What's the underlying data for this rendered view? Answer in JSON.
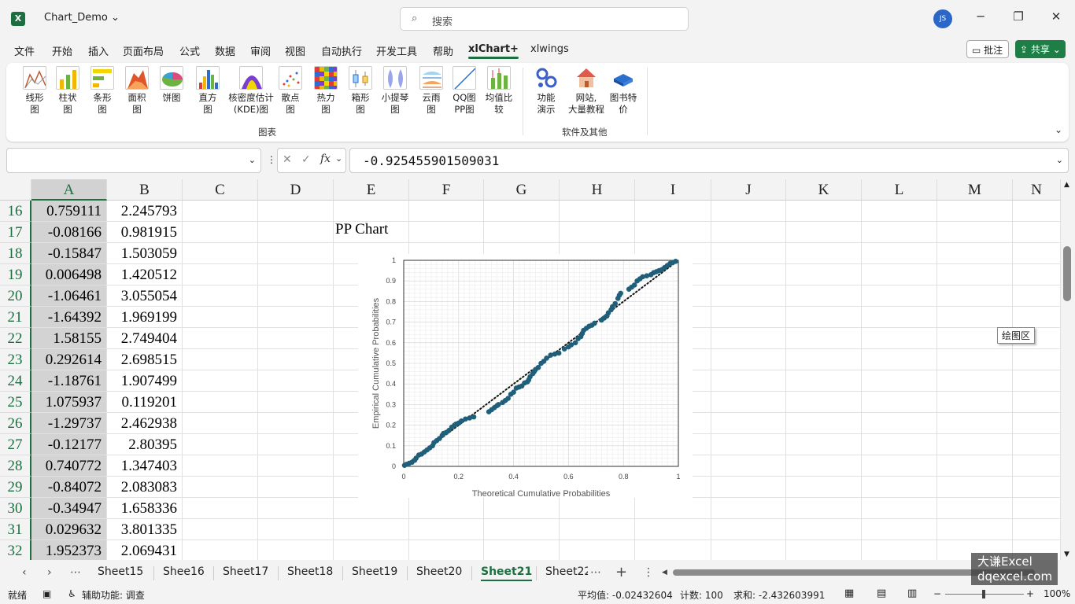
{
  "window": {
    "app_icon": "X",
    "doc_title": "Chart_Demo",
    "search_placeholder": "搜索",
    "user_initials": "JS"
  },
  "menu": [
    {
      "label": "文件",
      "active": false
    },
    {
      "label": "开始",
      "active": false
    },
    {
      "label": "插入",
      "active": false
    },
    {
      "label": "页面布局",
      "active": false
    },
    {
      "label": "公式",
      "active": false
    },
    {
      "label": "数据",
      "active": false
    },
    {
      "label": "审阅",
      "active": false
    },
    {
      "label": "视图",
      "active": false
    },
    {
      "label": "自动执行",
      "active": false
    },
    {
      "label": "开发工具",
      "active": false
    },
    {
      "label": "帮助",
      "active": false
    },
    {
      "label": "xlChart+",
      "active": true
    },
    {
      "label": "xlwings",
      "active": false
    }
  ],
  "header_buttons": {
    "comment": "批注",
    "share": "共享"
  },
  "ribbon": {
    "groups": [
      {
        "label": "图表",
        "buttons": [
          {
            "label": "线形\n图",
            "icon": "line-chart-icon"
          },
          {
            "label": "柱状\n图",
            "icon": "column-chart-icon"
          },
          {
            "label": "条形\n图",
            "icon": "bar-chart-icon"
          },
          {
            "label": "面积\n图",
            "icon": "area-chart-icon"
          },
          {
            "label": "饼图\n",
            "icon": "pie-chart-icon"
          },
          {
            "label": "直方\n图",
            "icon": "histogram-icon"
          },
          {
            "label": "核密度估计\n(KDE)图",
            "icon": "kde-chart-icon"
          },
          {
            "label": "散点\n图",
            "icon": "scatter-chart-icon"
          },
          {
            "label": "热力\n图",
            "icon": "heatmap-icon"
          },
          {
            "label": "箱形\n图",
            "icon": "box-plot-icon"
          },
          {
            "label": "小提琴\n图",
            "icon": "violin-plot-icon"
          },
          {
            "label": "云雨\n图",
            "icon": "raincloud-plot-icon"
          },
          {
            "label": "QQ图\nPP图",
            "icon": "qq-pp-plot-icon"
          },
          {
            "label": "均值比\n较",
            "icon": "mean-compare-icon"
          }
        ]
      },
      {
        "label": "软件及其他",
        "buttons": [
          {
            "label": "功能\n演示",
            "icon": "gears-icon"
          },
          {
            "label": "网站,\n大量教程",
            "icon": "house-icon"
          },
          {
            "label": "图书特\n价",
            "icon": "book-icon"
          }
        ]
      }
    ]
  },
  "formula_bar": {
    "name_box": "",
    "fx_label": "fx",
    "cancel_glyph": "✕",
    "enter_glyph": "✓",
    "value": "-0.925455901509031"
  },
  "sheet": {
    "columns": [
      "A",
      "B",
      "C",
      "D",
      "E",
      "F",
      "G",
      "H",
      "I",
      "J",
      "K",
      "L",
      "M",
      "N"
    ],
    "selected_column": "A",
    "rows": [
      {
        "num": "16",
        "a": "0.759111",
        "b": "2.245793"
      },
      {
        "num": "17",
        "a": "-0.08166",
        "b": "0.981915"
      },
      {
        "num": "18",
        "a": "-0.15847",
        "b": "1.503059"
      },
      {
        "num": "19",
        "a": "0.006498",
        "b": "1.420512"
      },
      {
        "num": "20",
        "a": "-1.06461",
        "b": "3.055054"
      },
      {
        "num": "21",
        "a": "-1.64392",
        "b": "1.969199"
      },
      {
        "num": "22",
        "a": "1.58155",
        "b": "2.749404"
      },
      {
        "num": "23",
        "a": "0.292614",
        "b": "2.698515"
      },
      {
        "num": "24",
        "a": "-1.18761",
        "b": "1.907499"
      },
      {
        "num": "25",
        "a": "1.075937",
        "b": "0.119201"
      },
      {
        "num": "26",
        "a": "-1.29737",
        "b": "2.462938"
      },
      {
        "num": "27",
        "a": "-0.12177",
        "b": "2.80395"
      },
      {
        "num": "28",
        "a": "0.740772",
        "b": "1.347403"
      },
      {
        "num": "29",
        "a": "-0.84072",
        "b": "2.083083"
      },
      {
        "num": "30",
        "a": "-0.34947",
        "b": "1.658336"
      },
      {
        "num": "31",
        "a": "0.029632",
        "b": "3.801335"
      },
      {
        "num": "32",
        "a": "1.952373",
        "b": "2.069431"
      }
    ]
  },
  "chart_title": "PP Chart",
  "chart_tooltip": "绘图区",
  "chart_data": {
    "type": "scatter",
    "title": "PP Chart",
    "xlabel": "Theoretical Cumulative Probabilities",
    "ylabel": "Empirical Cumulative Probabilities",
    "xlim": [
      0,
      1
    ],
    "ylim": [
      0,
      1
    ],
    "x_ticks": [
      "0",
      "0.2",
      "0.4",
      "0.6",
      "0.8",
      "1"
    ],
    "y_ticks": [
      "0",
      "0.1",
      "0.2",
      "0.3",
      "0.4",
      "0.5",
      "0.6",
      "0.7",
      "0.8",
      "0.9",
      "1"
    ],
    "grid": true,
    "point_color": "#1f5f7a",
    "reference_line": {
      "style": "dotted",
      "from": [
        0,
        0
      ],
      "to": [
        1,
        1
      ]
    },
    "series": [
      {
        "points": [
          [
            0.003,
            0.005
          ],
          [
            0.01,
            0.01
          ],
          [
            0.02,
            0.015
          ],
          [
            0.03,
            0.02
          ],
          [
            0.04,
            0.03
          ],
          [
            0.045,
            0.04
          ],
          [
            0.055,
            0.055
          ],
          [
            0.065,
            0.06
          ],
          [
            0.075,
            0.07
          ],
          [
            0.085,
            0.08
          ],
          [
            0.095,
            0.09
          ],
          [
            0.105,
            0.1
          ],
          [
            0.11,
            0.115
          ],
          [
            0.12,
            0.125
          ],
          [
            0.13,
            0.135
          ],
          [
            0.14,
            0.15
          ],
          [
            0.145,
            0.16
          ],
          [
            0.155,
            0.165
          ],
          [
            0.165,
            0.175
          ],
          [
            0.175,
            0.19
          ],
          [
            0.185,
            0.2
          ],
          [
            0.19,
            0.205
          ],
          [
            0.2,
            0.21
          ],
          [
            0.21,
            0.22
          ],
          [
            0.225,
            0.23
          ],
          [
            0.24,
            0.235
          ],
          [
            0.255,
            0.24
          ],
          [
            0.31,
            0.265
          ],
          [
            0.32,
            0.275
          ],
          [
            0.33,
            0.285
          ],
          [
            0.34,
            0.295
          ],
          [
            0.345,
            0.3
          ],
          [
            0.36,
            0.31
          ],
          [
            0.37,
            0.32
          ],
          [
            0.38,
            0.33
          ],
          [
            0.39,
            0.35
          ],
          [
            0.4,
            0.36
          ],
          [
            0.41,
            0.38
          ],
          [
            0.42,
            0.385
          ],
          [
            0.43,
            0.39
          ],
          [
            0.44,
            0.405
          ],
          [
            0.45,
            0.41
          ],
          [
            0.455,
            0.42
          ],
          [
            0.46,
            0.435
          ],
          [
            0.47,
            0.45
          ],
          [
            0.475,
            0.46
          ],
          [
            0.48,
            0.47
          ],
          [
            0.49,
            0.48
          ],
          [
            0.5,
            0.5
          ],
          [
            0.51,
            0.51
          ],
          [
            0.52,
            0.525
          ],
          [
            0.535,
            0.54
          ],
          [
            0.55,
            0.545
          ],
          [
            0.565,
            0.55
          ],
          [
            0.585,
            0.57
          ],
          [
            0.6,
            0.58
          ],
          [
            0.61,
            0.59
          ],
          [
            0.625,
            0.6
          ],
          [
            0.635,
            0.62
          ],
          [
            0.645,
            0.63
          ],
          [
            0.65,
            0.645
          ],
          [
            0.655,
            0.66
          ],
          [
            0.665,
            0.67
          ],
          [
            0.675,
            0.68
          ],
          [
            0.685,
            0.685
          ],
          [
            0.695,
            0.695
          ],
          [
            0.72,
            0.71
          ],
          [
            0.73,
            0.72
          ],
          [
            0.74,
            0.73
          ],
          [
            0.745,
            0.745
          ],
          [
            0.755,
            0.76
          ],
          [
            0.76,
            0.775
          ],
          [
            0.77,
            0.79
          ],
          [
            0.78,
            0.815
          ],
          [
            0.785,
            0.83
          ],
          [
            0.79,
            0.84
          ],
          [
            0.82,
            0.86
          ],
          [
            0.83,
            0.87
          ],
          [
            0.84,
            0.88
          ],
          [
            0.85,
            0.9
          ],
          [
            0.86,
            0.91
          ],
          [
            0.87,
            0.92
          ],
          [
            0.885,
            0.925
          ],
          [
            0.9,
            0.93
          ],
          [
            0.91,
            0.94
          ],
          [
            0.92,
            0.945
          ],
          [
            0.93,
            0.95
          ],
          [
            0.94,
            0.955
          ],
          [
            0.95,
            0.965
          ],
          [
            0.96,
            0.975
          ],
          [
            0.97,
            0.985
          ],
          [
            0.98,
            0.99
          ],
          [
            0.99,
            0.995
          ]
        ]
      }
    ]
  },
  "sheet_tabs": [
    {
      "label": "Sheet15",
      "active": false
    },
    {
      "label": "Shee16",
      "active": false
    },
    {
      "label": "Sheet17",
      "active": false
    },
    {
      "label": "Sheet18",
      "active": false
    },
    {
      "label": "Sheet19",
      "active": false
    },
    {
      "label": "Sheet20",
      "active": false
    },
    {
      "label": "Sheet21",
      "active": true
    },
    {
      "label": "Sheet22",
      "active": false
    }
  ],
  "watermark": {
    "line1": "大谦Excel",
    "line2": "dqexcel.com"
  },
  "status": {
    "ready": "就绪",
    "accessibility": "辅助功能: 调查",
    "average": "平均值: -0.02432604",
    "count": "计数: 100",
    "sum": "求和: -2.432603991",
    "zoom": "100%"
  }
}
